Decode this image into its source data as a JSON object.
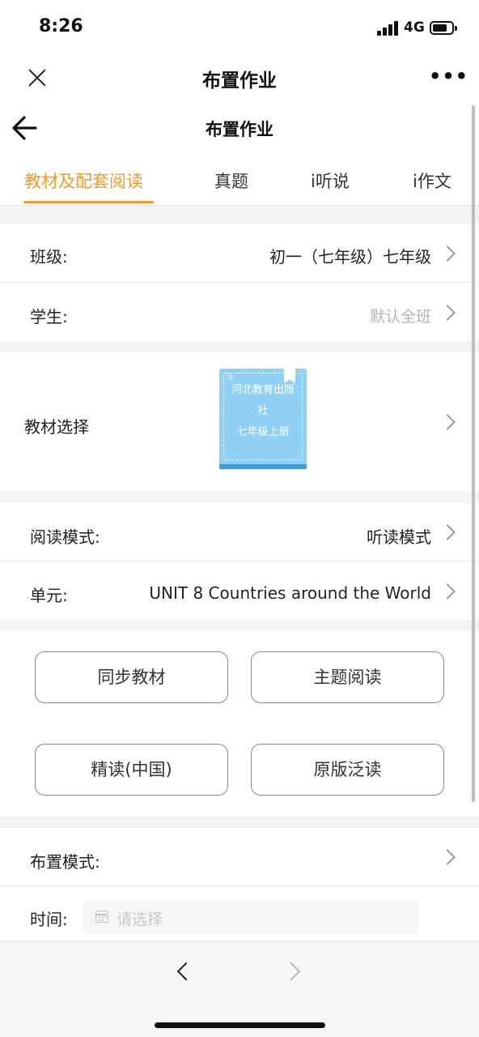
{
  "status_bar": {
    "time": "8:26",
    "network": "4G"
  },
  "app_bar": {
    "title": "布置作业",
    "more": "•••"
  },
  "nav_bar": {
    "title": "布置作业"
  },
  "tabs": [
    {
      "label": "教材及配套阅读",
      "active": true
    },
    {
      "label": "真题",
      "active": false
    },
    {
      "label": "i听说",
      "active": false
    },
    {
      "label": "i作文",
      "active": false
    }
  ],
  "form": {
    "class_label": "班级:",
    "class_value": "初一（七年级）七年级",
    "student_label": "学生:",
    "student_value": "默认全班",
    "textbook_label": "教材选择",
    "book": {
      "publisher_line1": "河北教育出版",
      "publisher_line2": "社",
      "grade": "七年级上册"
    },
    "reading_mode_label": "阅读模式:",
    "reading_mode_value": "听读模式",
    "unit_label": "单元:",
    "unit_value": "UNIT 8 Countries around the World"
  },
  "buttons": [
    {
      "label": "同步教材"
    },
    {
      "label": "主题阅读"
    },
    {
      "label": "精读(中国)"
    },
    {
      "label": "原版泛读"
    }
  ],
  "assign": {
    "mode_label": "布置模式:",
    "time_label": "时间:",
    "time_placeholder": "请选择"
  },
  "colors": {
    "accent": "#f29a2e",
    "book": "#8fd0f4"
  }
}
